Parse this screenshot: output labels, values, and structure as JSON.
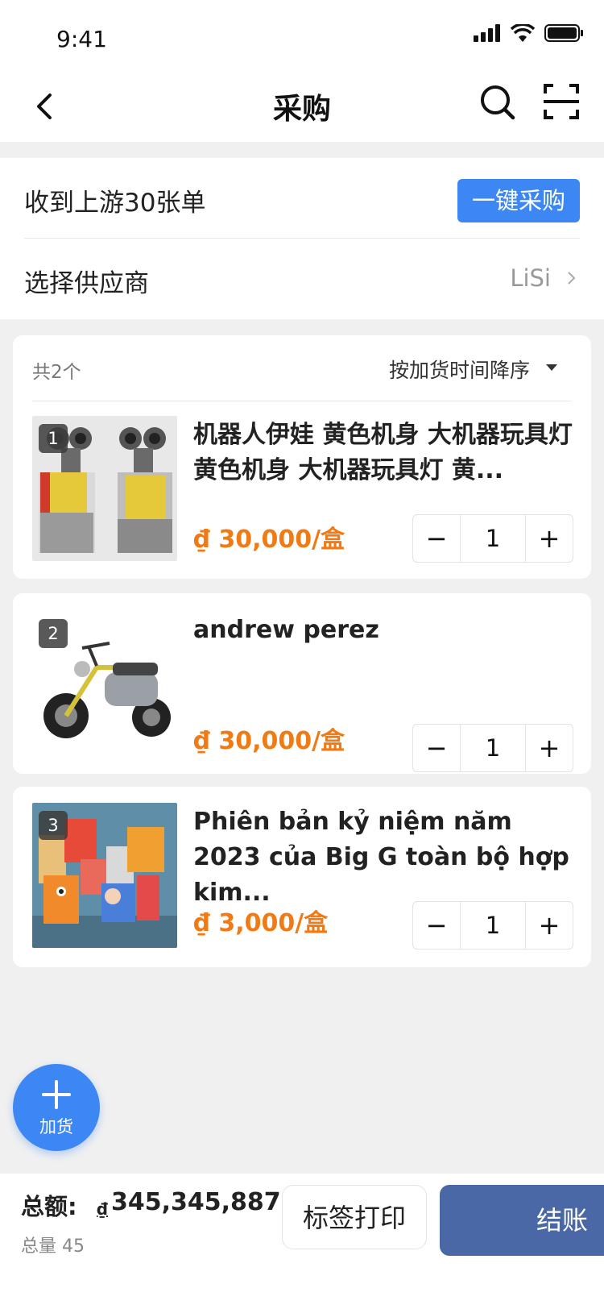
{
  "status_bar": {
    "time": "9:41"
  },
  "nav": {
    "title": "采购"
  },
  "upstream": {
    "label": "收到上游30张单",
    "button": "一键采购"
  },
  "supplier": {
    "label": "选择供应商",
    "value": "LiSi"
  },
  "list": {
    "count": "共2个",
    "sort": "按加货时间降序",
    "items": [
      {
        "index": "1",
        "name": "机器人伊娃 黄色机身 大机器玩具灯  黄色机身 大机器玩具灯 黄...",
        "price": "₫ 30,000/盒",
        "qty": "1",
        "image": "robot-toy"
      },
      {
        "index": "2",
        "name": "andrew perez",
        "price": "₫ 30,000/盒",
        "qty": "1",
        "image": "motor-scooter"
      },
      {
        "index": "3",
        "name": "Phiên bản kỷ niệm năm 2023 của Big G toàn bộ hợp kim...",
        "price": "₫ 3,000/盒",
        "qty": "1",
        "image": "paper-toys"
      }
    ]
  },
  "fab": {
    "label": "加货"
  },
  "footer": {
    "total_label": "总额:",
    "currency": "₫",
    "total_amount": "345,345,887",
    "total_qty": "总量 45",
    "print_button": "标签打印",
    "checkout_button": "结账"
  },
  "colors": {
    "primary": "#3d87f5",
    "price": "#f07a14",
    "checkout": "#4a68a5"
  }
}
